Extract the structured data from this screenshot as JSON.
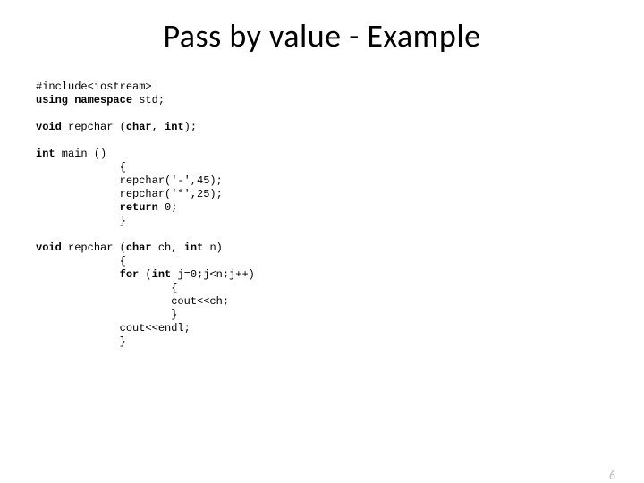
{
  "title": "Pass by value - Example",
  "code": {
    "l1": "#include<iostream>",
    "l2a": "using namespace",
    "l2b": " std;",
    "l3a": "void",
    "l3b": " repchar (",
    "l3c": "char",
    "l3d": ", ",
    "l3e": "int",
    "l3f": ");",
    "l4a": "int",
    "l4b": " main ()",
    "l5": "             {",
    "l6": "             repchar('-',45);",
    "l7": "             repchar('*',25);",
    "l8a": "             ",
    "l8b": "return",
    "l8c": " 0;",
    "l9": "             }",
    "l10a": "void",
    "l10b": " repchar (",
    "l10c": "char",
    "l10d": " ch, ",
    "l10e": "int",
    "l10f": " n)",
    "l11": "             {",
    "l12a": "             ",
    "l12b": "for",
    "l12c": " (",
    "l12d": "int",
    "l12e": " j=0;j<n;j++)",
    "l13": "                     {",
    "l14": "                     cout<<ch;",
    "l15": "                     }",
    "l16": "             cout<<endl;",
    "l17": "             }"
  },
  "pagenum": "6"
}
